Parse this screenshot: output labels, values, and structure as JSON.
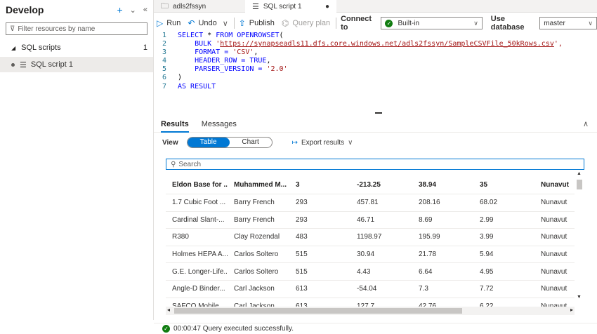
{
  "left": {
    "title": "Develop",
    "filter_placeholder": "Filter resources by name",
    "group": {
      "label": "SQL scripts",
      "count": "1"
    },
    "item": {
      "label": "SQL script 1"
    }
  },
  "tabs": [
    {
      "label": "adls2fssyn"
    },
    {
      "label": "SQL script 1",
      "modified": "●"
    }
  ],
  "toolbar": {
    "run": "Run",
    "undo": "Undo",
    "publish": "Publish",
    "query_plan": "Query plan",
    "connect_to_label": "Connect to",
    "connect_to_value": "Built-in",
    "use_database_label": "Use database",
    "use_database_value": "master"
  },
  "editor": {
    "lines": [
      {
        "n": "1",
        "parts": [
          {
            "t": "SELECT",
            "c": "kw"
          },
          {
            "t": " * ",
            "c": "plain"
          },
          {
            "t": "FROM OPENROWSET",
            "c": "kw"
          },
          {
            "t": "(",
            "c": "plain"
          }
        ]
      },
      {
        "n": "2",
        "parts": [
          {
            "t": "    BULK ",
            "c": "kw"
          },
          {
            "t": "'",
            "c": "str"
          },
          {
            "t": "https://synapseadls11.dfs.core.windows.net/adls2fssyn/SampleCSVFile_50kRows.csv",
            "c": "url"
          },
          {
            "t": "',",
            "c": "str"
          }
        ]
      },
      {
        "n": "3",
        "parts": [
          {
            "t": "    FORMAT = ",
            "c": "kw"
          },
          {
            "t": "'CSV'",
            "c": "str"
          },
          {
            "t": ",",
            "c": "plain"
          }
        ]
      },
      {
        "n": "4",
        "parts": [
          {
            "t": "    HEADER_ROW = ",
            "c": "kw"
          },
          {
            "t": "TRUE",
            "c": "kw"
          },
          {
            "t": ",",
            "c": "plain"
          }
        ]
      },
      {
        "n": "5",
        "parts": [
          {
            "t": "    PARSER_VERSION = ",
            "c": "kw"
          },
          {
            "t": "'2.0'",
            "c": "str"
          }
        ]
      },
      {
        "n": "6",
        "parts": [
          {
            "t": ")",
            "c": "plain"
          }
        ]
      },
      {
        "n": "7",
        "parts": [
          {
            "t": "AS RESULT",
            "c": "kw"
          }
        ]
      }
    ]
  },
  "results": {
    "tab_results": "Results",
    "tab_messages": "Messages",
    "view_label": "View",
    "view_table": "Table",
    "view_chart": "Chart",
    "export": "Export results",
    "search_placeholder": "Search",
    "header": [
      "Eldon Base for ...",
      "Muhammed M...",
      "3",
      "-213.25",
      "38.94",
      "35",
      "Nunavut"
    ],
    "rows": [
      [
        "1.7 Cubic Foot ...",
        "Barry French",
        "293",
        "457.81",
        "208.16",
        "68.02",
        "Nunavut"
      ],
      [
        "Cardinal Slant-...",
        "Barry French",
        "293",
        "46.71",
        "8.69",
        "2.99",
        "Nunavut"
      ],
      [
        "R380",
        "Clay Rozendal",
        "483",
        "1198.97",
        "195.99",
        "3.99",
        "Nunavut"
      ],
      [
        "Holmes HEPA A...",
        "Carlos Soltero",
        "515",
        "30.94",
        "21.78",
        "5.94",
        "Nunavut"
      ],
      [
        "G.E. Longer-Life...",
        "Carlos Soltero",
        "515",
        "4.43",
        "6.64",
        "4.95",
        "Nunavut"
      ],
      [
        "Angle-D Binder...",
        "Carl Jackson",
        "613",
        "-54.04",
        "7.3",
        "7.72",
        "Nunavut"
      ],
      [
        "SAFCO Mobile ...",
        "Carl Jackson",
        "613",
        "127.7",
        "42.76",
        "6.22",
        "Nunavut"
      ]
    ]
  },
  "status": {
    "text": "00:00:47 Query executed successfully."
  }
}
